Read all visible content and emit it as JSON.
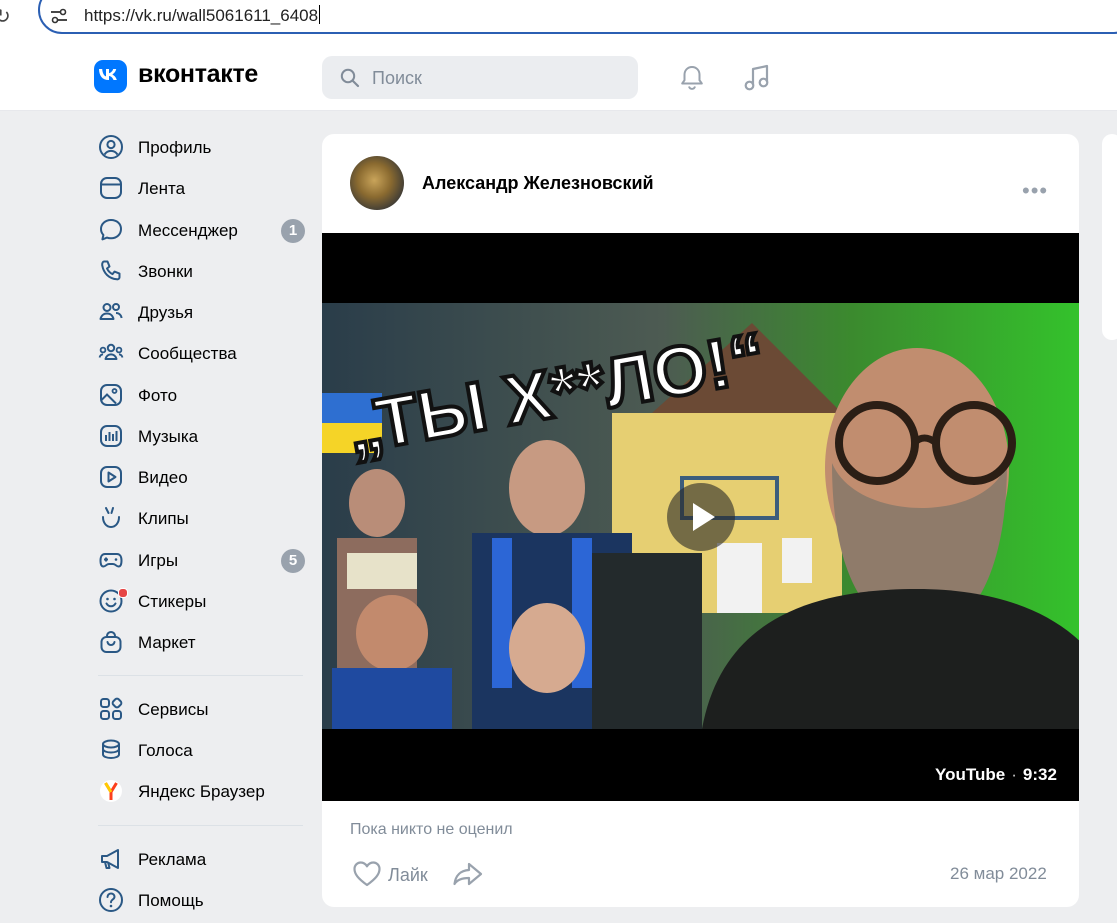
{
  "browser": {
    "url": "https://vk.ru/wall5061611_6408"
  },
  "header": {
    "logo_text": "вконтакте",
    "search_placeholder": "Поиск"
  },
  "sidebar": {
    "items": [
      {
        "label": "Профиль",
        "icon": "user-icon"
      },
      {
        "label": "Лента",
        "icon": "feed-icon"
      },
      {
        "label": "Мессенджер",
        "icon": "message-icon",
        "badge": "1"
      },
      {
        "label": "Звонки",
        "icon": "phone-icon"
      },
      {
        "label": "Друзья",
        "icon": "friends-icon"
      },
      {
        "label": "Сообщества",
        "icon": "communities-icon"
      },
      {
        "label": "Фото",
        "icon": "photo-icon"
      },
      {
        "label": "Музыка",
        "icon": "music-icon"
      },
      {
        "label": "Видео",
        "icon": "video-icon"
      },
      {
        "label": "Клипы",
        "icon": "clips-icon"
      },
      {
        "label": "Игры",
        "icon": "games-icon",
        "badge": "5"
      },
      {
        "label": "Стикеры",
        "icon": "sticker-icon"
      },
      {
        "label": "Маркет",
        "icon": "market-icon"
      }
    ],
    "items2": [
      {
        "label": "Сервисы",
        "icon": "services-icon"
      },
      {
        "label": "Голоса",
        "icon": "votes-icon"
      },
      {
        "label": "Яндекс Браузер",
        "icon": "yandex-icon"
      }
    ],
    "items3": [
      {
        "label": "Реклама",
        "icon": "ads-icon"
      },
      {
        "label": "Помощь",
        "icon": "help-icon"
      }
    ]
  },
  "post": {
    "author": "Александр Железновский",
    "video": {
      "thumbnail_text": "„ТЫ Х**ЛО!“",
      "source": "YouTube",
      "duration": "9:32"
    },
    "likes_text": "Пока никто не оценил",
    "like_label": "Лайк",
    "date": "26 мар 2022"
  },
  "colors": {
    "accent": "#0077ff",
    "badge": "#99a2ad",
    "muted": "#818c99",
    "background": "#edeef0"
  }
}
